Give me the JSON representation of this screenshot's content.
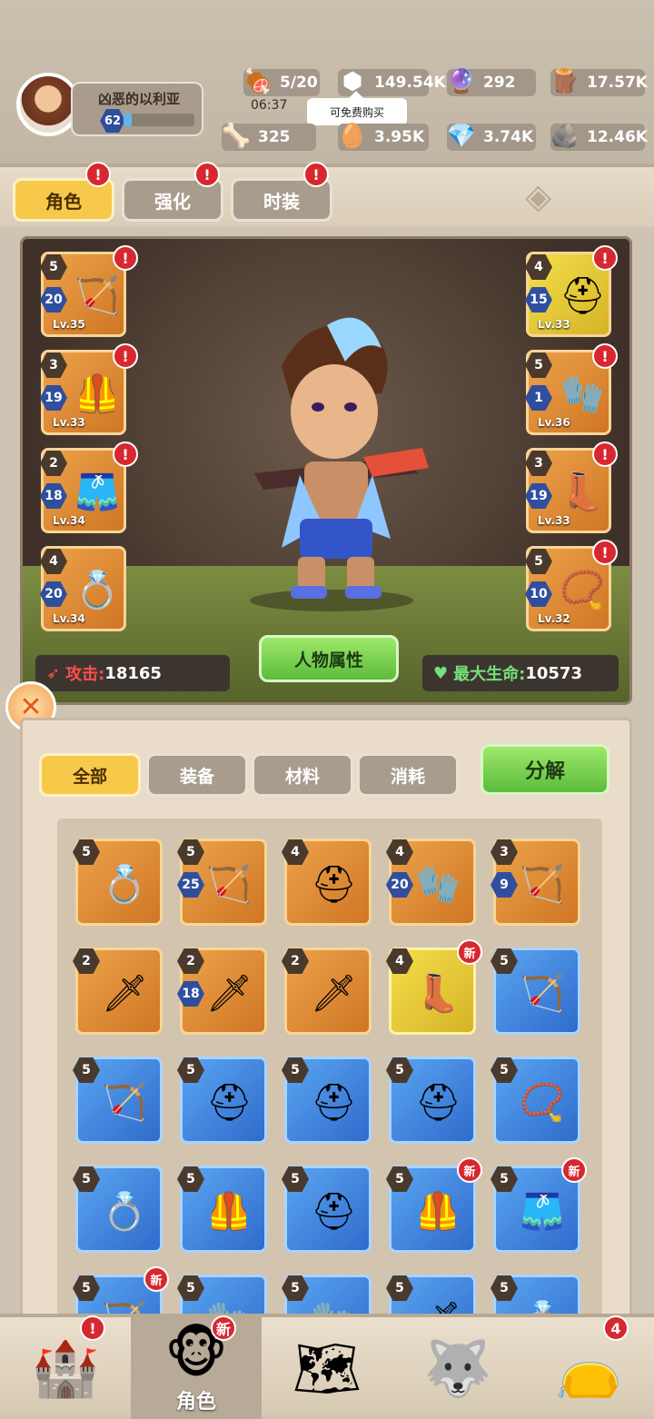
{
  "player": {
    "name": "凶恶的以利亚",
    "level": "62",
    "xp_fraction": 0.12
  },
  "resources": {
    "energy": "5/20",
    "energy_timer": "06:37",
    "gear_parts": "149.54K",
    "pearls": "292",
    "wood": "17.57K",
    "bones": "325",
    "eggs": "3.95K",
    "gems": "3.74K",
    "stone": "12.46K"
  },
  "tooltip": "可免费购买",
  "tabs": [
    "角色",
    "强化",
    "时装"
  ],
  "equipment": [
    {
      "stars": "5",
      "level": "20",
      "lv": "Lv.35",
      "icon": "🏹"
    },
    {
      "stars": "3",
      "level": "19",
      "lv": "Lv.33",
      "icon": "🦺"
    },
    {
      "stars": "2",
      "level": "18",
      "lv": "Lv.34",
      "icon": "🩳"
    },
    {
      "stars": "4",
      "level": "20",
      "lv": "Lv.34",
      "icon": "💍"
    },
    {
      "stars": "4",
      "level": "15",
      "lv": "Lv.33",
      "icon": "⛑"
    },
    {
      "stars": "5",
      "level": "1",
      "lv": "Lv.36",
      "icon": "🧤"
    },
    {
      "stars": "3",
      "level": "19",
      "lv": "Lv.33",
      "icon": "👢"
    },
    {
      "stars": "5",
      "level": "10",
      "lv": "Lv.32",
      "icon": "📿"
    }
  ],
  "stats": {
    "attack_label": "攻击:",
    "attack": "18165",
    "hp_label": "最大生命:",
    "hp": "10573"
  },
  "attr_button": "人物属性",
  "filters": [
    "全部",
    "装备",
    "材料",
    "消耗"
  ],
  "decompose": "分解",
  "inventory": [
    {
      "stars": "5",
      "level": "",
      "rarity": "orange",
      "icon": "💍"
    },
    {
      "stars": "5",
      "level": "25",
      "rarity": "orange",
      "icon": "🏹"
    },
    {
      "stars": "4",
      "level": "",
      "rarity": "orange",
      "icon": "⛑"
    },
    {
      "stars": "4",
      "level": "20",
      "rarity": "orange",
      "icon": "🧤"
    },
    {
      "stars": "3",
      "level": "9",
      "rarity": "orange",
      "icon": "🏹"
    },
    {
      "stars": "2",
      "level": "",
      "rarity": "orange",
      "icon": "🗡"
    },
    {
      "stars": "2",
      "level": "18",
      "rarity": "orange",
      "icon": "🗡"
    },
    {
      "stars": "2",
      "level": "",
      "rarity": "orange",
      "icon": "🗡"
    },
    {
      "stars": "4",
      "level": "",
      "rarity": "gold",
      "icon": "👢",
      "new": "新"
    },
    {
      "stars": "5",
      "level": "",
      "rarity": "blue",
      "icon": "🏹"
    },
    {
      "stars": "5",
      "level": "",
      "rarity": "blue",
      "icon": "🏹"
    },
    {
      "stars": "5",
      "level": "",
      "rarity": "blue",
      "icon": "⛑"
    },
    {
      "stars": "5",
      "level": "",
      "rarity": "blue",
      "icon": "⛑"
    },
    {
      "stars": "5",
      "level": "",
      "rarity": "blue",
      "icon": "⛑"
    },
    {
      "stars": "5",
      "level": "",
      "rarity": "blue",
      "icon": "📿"
    },
    {
      "stars": "5",
      "level": "",
      "rarity": "blue",
      "icon": "💍"
    },
    {
      "stars": "5",
      "level": "",
      "rarity": "blue",
      "icon": "🦺"
    },
    {
      "stars": "5",
      "level": "",
      "rarity": "blue",
      "icon": "⛑"
    },
    {
      "stars": "5",
      "level": "",
      "rarity": "blue",
      "icon": "🦺",
      "new": "新"
    },
    {
      "stars": "5",
      "level": "",
      "rarity": "blue",
      "icon": "🩳",
      "new": "新"
    },
    {
      "stars": "5",
      "level": "",
      "rarity": "blue",
      "icon": "🏹",
      "new": "新"
    },
    {
      "stars": "5",
      "level": "",
      "rarity": "blue",
      "icon": "🧤"
    },
    {
      "stars": "5",
      "level": "",
      "rarity": "blue",
      "icon": "🧤"
    },
    {
      "stars": "5",
      "level": "",
      "rarity": "blue",
      "icon": "🗡"
    },
    {
      "stars": "5",
      "level": "",
      "rarity": "blue",
      "icon": "💍"
    }
  ],
  "bottom_nav": [
    {
      "icon": "🏰",
      "label": "",
      "alert": "!"
    },
    {
      "icon": "🐵",
      "label": "角色",
      "alert": "新"
    },
    {
      "icon": "🗺",
      "label": "",
      "alert": ""
    },
    {
      "icon": "🐺",
      "label": "",
      "alert": ""
    },
    {
      "icon": "👝",
      "label": "",
      "alert": "4"
    }
  ],
  "colors": {
    "accent_gold": "#f7c94a",
    "accent_green": "#5dbb3b",
    "alert_red": "#d7282f",
    "rare_blue": "#2f6bcc",
    "epic_orange": "#cf7624"
  }
}
